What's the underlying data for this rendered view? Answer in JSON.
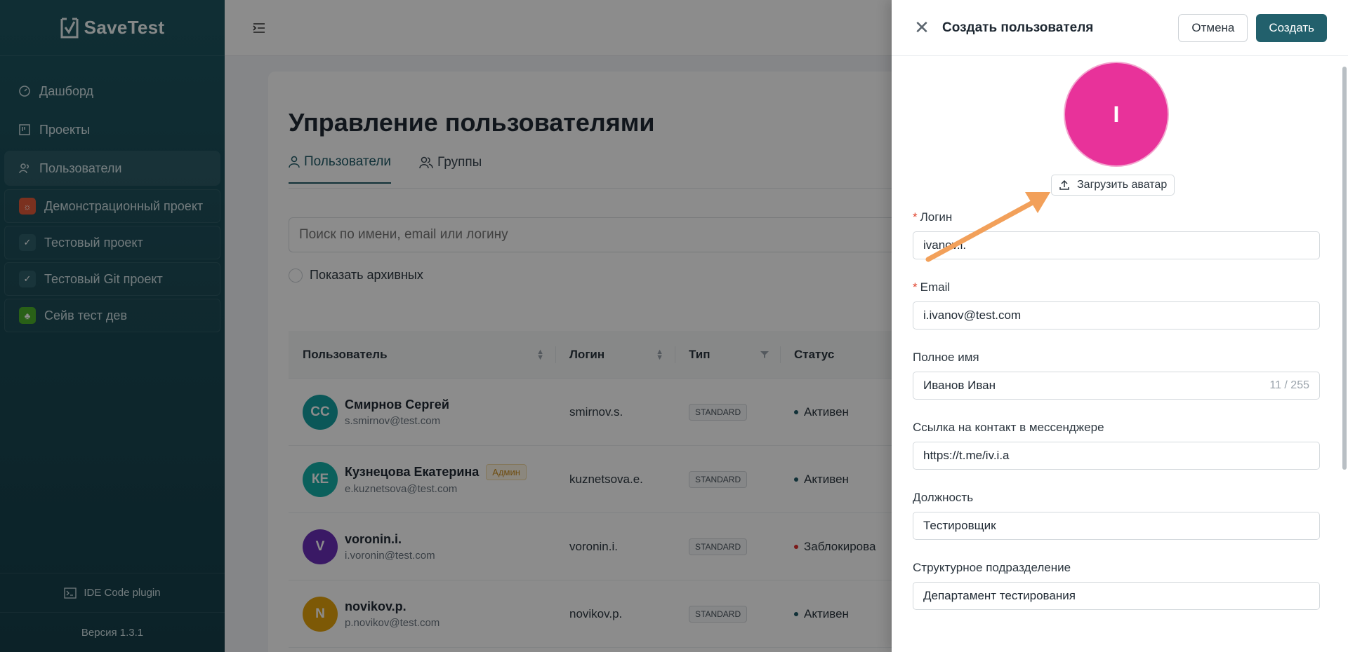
{
  "sidebar": {
    "brand": "SaveTest",
    "nav": [
      {
        "label": "Дашборд",
        "icon": "gauge-icon"
      },
      {
        "label": "Проекты",
        "icon": "board-icon"
      },
      {
        "label": "Пользователи",
        "icon": "users-icon",
        "active": true
      }
    ],
    "projects": [
      {
        "label": "Демонстрационный проект",
        "icon": "bug-icon",
        "color": "#e05a3a"
      },
      {
        "label": "Тестовый проект",
        "icon": "checklist-icon",
        "color": "#2e5f6a"
      },
      {
        "label": "Тестовый Git проект",
        "icon": "checklist-icon",
        "color": "#2e5f6a"
      },
      {
        "label": "Сейв тест дев",
        "icon": "plant-icon",
        "color": "#4caf2a"
      }
    ],
    "ide_plugin": "IDE Code plugin",
    "version": "Версия 1.3.1"
  },
  "topbar": {
    "menu_icon": "menu-fold-icon"
  },
  "main": {
    "title": "Управление пользователями",
    "tabs": [
      {
        "label": "Пользователи",
        "active": true
      },
      {
        "label": "Группы"
      }
    ],
    "search_placeholder": "Поиск по имени, email или логину",
    "show_archived": "Показать архивных",
    "table": {
      "headers": [
        "Пользователь",
        "Логин",
        "Тип",
        "Статус"
      ],
      "rows": [
        {
          "initials": "СС",
          "avatar_color": "#159fa0",
          "name": "Смирнов Сергей",
          "email": "s.smirnov@test.com",
          "admin": "",
          "login": "smirnov.s.",
          "type": "STANDARD",
          "status": "Активен",
          "status_color": "#1f5a66"
        },
        {
          "initials": "КЕ",
          "avatar_color": "#15b0a8",
          "name": "Кузнецова Екатерина",
          "email": "e.kuznetsova@test.com",
          "admin": "Админ",
          "login": "kuznetsova.e.",
          "type": "STANDARD",
          "status": "Активен",
          "status_color": "#1f5a66"
        },
        {
          "initials": "V",
          "avatar_color": "#6a2fb8",
          "name": "voronin.i.",
          "email": "i.voronin@test.com",
          "admin": "",
          "login": "voronin.i.",
          "type": "STANDARD",
          "status": "Заблокирова",
          "status_color": "#e0302f"
        },
        {
          "initials": "N",
          "avatar_color": "#e3a20c",
          "name": "novikov.p.",
          "email": "p.novikov@test.com",
          "admin": "",
          "login": "novikov.p.",
          "type": "STANDARD",
          "status": "Активен",
          "status_color": "#1f5a66"
        }
      ]
    }
  },
  "drawer": {
    "title": "Создать пользователя",
    "cancel": "Отмена",
    "create": "Создать",
    "avatar_initial": "I",
    "avatar_color": "#e8329a",
    "upload": "Загрузить аватар",
    "fields": {
      "login": {
        "label": "Логин",
        "value": "ivanov.i."
      },
      "email": {
        "label": "Email",
        "value": "i.ivanov@test.com"
      },
      "full_name": {
        "label": "Полное имя",
        "value": "Иванов Иван",
        "counter": "11 / 255"
      },
      "messenger": {
        "label": "Ссылка на контакт в мессенджере",
        "value": "https://t.me/iv.i.a"
      },
      "position": {
        "label": "Должность",
        "value": "Тестировщик"
      },
      "department": {
        "label": "Структурное подразделение",
        "value": "Департамент тестирования"
      }
    },
    "required_mark": "*"
  },
  "annotation": {
    "arrow_color": "#f2a05a"
  }
}
